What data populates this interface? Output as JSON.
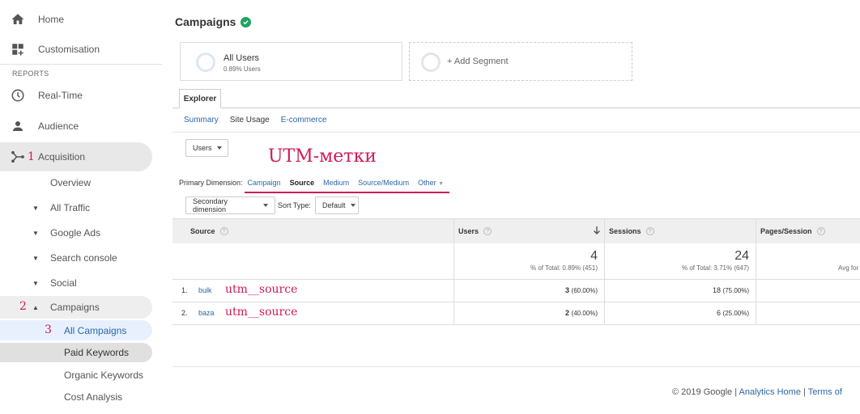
{
  "sidebar": {
    "home": "Home",
    "customisation": "Customisation",
    "reports_header": "REPORTS",
    "realtime": "Real-Time",
    "audience": "Audience",
    "acquisition": "Acquisition",
    "acquisition_marker": "1",
    "overview": "Overview",
    "all_traffic": "All Traffic",
    "google_ads": "Google Ads",
    "search_console": "Search console",
    "social": "Social",
    "campaigns": "Campaigns",
    "campaigns_marker": "2",
    "all_campaigns": "All Campaigns",
    "all_campaigns_marker": "3",
    "paid_keywords": "Paid Keywords",
    "organic_keywords": "Organic Keywords",
    "cost_analysis": "Cost Analysis"
  },
  "header": {
    "title": "Campaigns"
  },
  "segments": {
    "all_users_label": "All Users",
    "all_users_sub": "0.89% Users",
    "add_segment": "+ Add Segment"
  },
  "tabs": {
    "explorer": "Explorer"
  },
  "subtabs": {
    "summary": "Summary",
    "site_usage": "Site Usage",
    "ecommerce": "E-commerce"
  },
  "metric_select": "Users",
  "annotation_title": "UTM-метки",
  "primary_dimension": {
    "label": "Primary Dimension:",
    "campaign": "Campaign",
    "source": "Source",
    "medium": "Medium",
    "source_medium": "Source/Medium",
    "other": "Other"
  },
  "secondary_dimension": "Secondary dimension",
  "sort_type_label": "Sort Type:",
  "sort_type_value": "Default",
  "table": {
    "headers": {
      "source": "Source",
      "users": "Users",
      "sessions": "Sessions",
      "pages_session": "Pages/Session"
    },
    "totals": {
      "users": "4",
      "users_pct": "% of Total: 0.89% (451)",
      "sessions": "24",
      "sessions_pct": "% of Total: 3.71% (647)",
      "pages_avg": "Avg for"
    },
    "rows": [
      {
        "num": "1.",
        "source": "bulk",
        "annotation": "utm__source",
        "users": "3",
        "users_pct": "(60.00%)",
        "sessions": "18",
        "sessions_pct": "(75.00%)"
      },
      {
        "num": "2.",
        "source": "baza",
        "annotation": "utm__source",
        "users": "2",
        "users_pct": "(40.00%)",
        "sessions": "6",
        "sessions_pct": "(25.00%)"
      }
    ]
  },
  "footer": {
    "copyright": "© 2019 Google | ",
    "analytics_home": "Analytics Home",
    "sep": " | ",
    "terms": "Terms of"
  },
  "colors": {
    "annotation": "#d01a5a",
    "link": "#2a67a8",
    "selected_bg": "#e8f0fe",
    "hover_bg": "#e8e8e8"
  }
}
